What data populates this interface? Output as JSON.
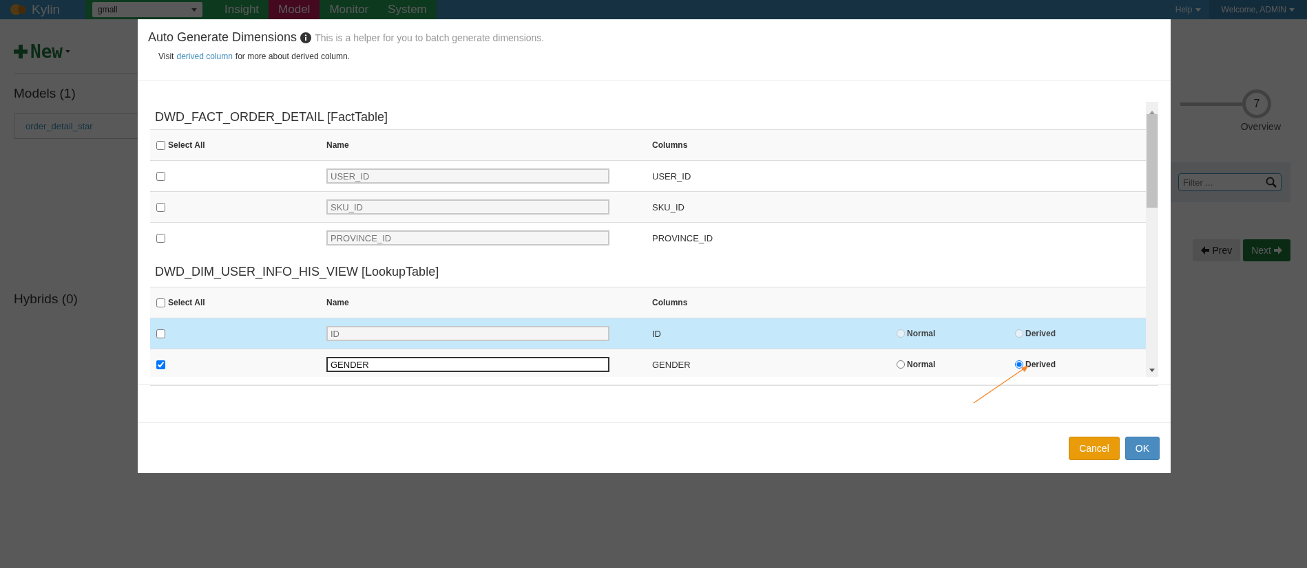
{
  "topbar": {
    "logo": "Kylin",
    "project": "gmall",
    "help": "Help",
    "welcome": "Welcome, ADMIN",
    "nav": [
      {
        "label": "Insight",
        "selected": false
      },
      {
        "label": "Model",
        "selected": true
      },
      {
        "label": "Monitor",
        "selected": false
      },
      {
        "label": "System",
        "selected": false
      }
    ]
  },
  "sidebar": {
    "new_button": "New",
    "models_heading": "Models (1)",
    "models": [
      "order_detail_star"
    ],
    "hybrids_heading": "Hybrids (0)"
  },
  "wizard": {
    "step_number": "7",
    "step_label": "Overview",
    "filter_placeholder": "Filter ...",
    "prev": "Prev",
    "next": "Next"
  },
  "dialog": {
    "title": "Auto Generate Dimensions",
    "subtitle": "This is a helper for you to batch generate dimensions.",
    "note_before": "Visit",
    "note_link": "derived column",
    "note_after": "for more about derived column.",
    "tables": [
      {
        "title": "DWD_FACT_ORDER_DETAIL [FactTable]",
        "select_all": "Select All",
        "select_all_checked": false,
        "name_heading": "Name",
        "columns_heading": "Columns",
        "rows": [
          {
            "checked": false,
            "hovered": false,
            "name": "USER_ID",
            "column": "USER_ID"
          },
          {
            "checked": false,
            "hovered": false,
            "name": "SKU_ID",
            "column": "SKU_ID"
          },
          {
            "checked": false,
            "hovered": false,
            "name": "PROVINCE_ID",
            "column": "PROVINCE_ID"
          }
        ]
      },
      {
        "title": "DWD_DIM_USER_INFO_HIS_VIEW [LookupTable]",
        "select_all": "Select All",
        "select_all_checked": false,
        "name_heading": "Name",
        "columns_heading": "Columns",
        "rows": [
          {
            "checked": false,
            "hovered": true,
            "name": "ID",
            "column": "ID",
            "options": [
              {
                "label": "Normal",
                "selected": false
              },
              {
                "label": "Derived",
                "selected": false
              }
            ]
          },
          {
            "checked": true,
            "hovered": false,
            "name": "GENDER",
            "column": "GENDER",
            "options": [
              {
                "label": "Normal",
                "selected": false
              },
              {
                "label": "Derived",
                "selected": true
              }
            ]
          }
        ]
      }
    ],
    "cancel": "Cancel",
    "ok": "OK"
  }
}
